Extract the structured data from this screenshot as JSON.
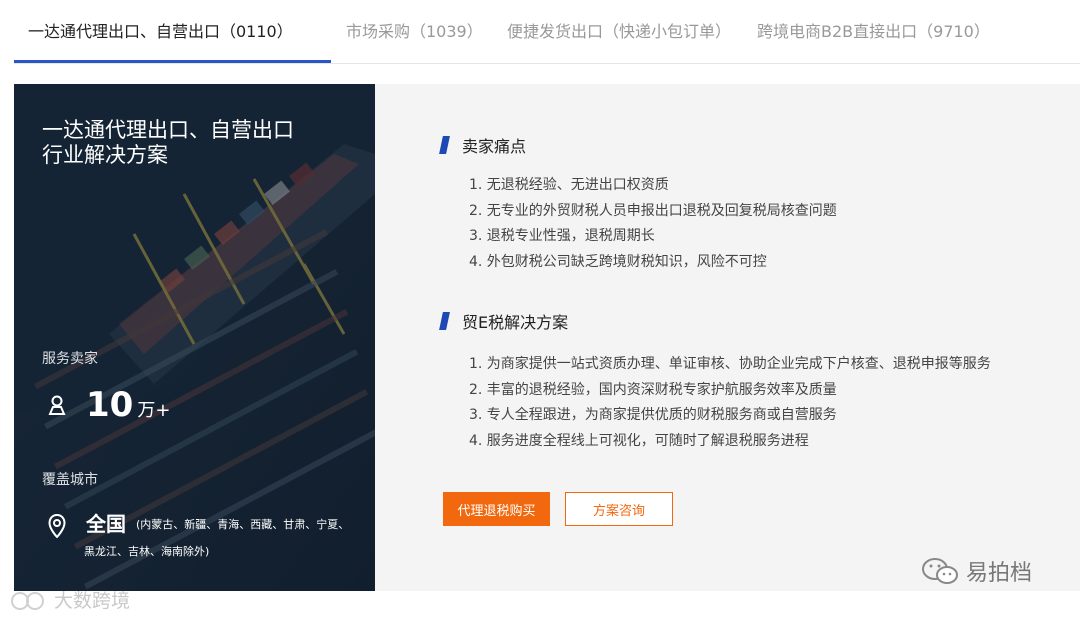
{
  "tabs": [
    {
      "label": "一达通代理出口、自营出口（0110）",
      "active": true
    },
    {
      "label": "市场采购（1039）",
      "active": false
    },
    {
      "label": "便捷发货出口（快递小包订单）",
      "active": false
    },
    {
      "label": "跨境电商B2B直接出口（9710）",
      "active": false
    }
  ],
  "hero": {
    "title_line1": "一达通代理出口、自营出口",
    "title_line2": "行业解决方案",
    "sellers_label": "服务卖家",
    "sellers_number": "10",
    "sellers_unit": "万+",
    "coverage_label": "覆盖城市",
    "coverage_big": "全国",
    "coverage_detail_line1": "(内蒙古、新疆、青海、西藏、甘肃、宁夏、",
    "coverage_detail_line2": "黑龙江、吉林、海南除外)"
  },
  "pain_points": {
    "heading": "卖家痛点",
    "items": [
      "1. 无退税经验、无进出口权资质",
      "2. 无专业的外贸财税人员申报出口退税及回复税局核查问题",
      "3. 退税专业性强，退税周期长",
      "4. 外包财税公司缺乏跨境财税知识，风险不可控"
    ]
  },
  "solution": {
    "heading": "贸E税解决方案",
    "items": [
      "1. 为商家提供一站式资质办理、单证审核、协助企业完成下户核查、退税申报等服务",
      "2. 丰富的退税经验，国内资深财税专家护航服务效率及质量",
      "3. 专人全程跟进，为商家提供优质的财税服务商或自营服务",
      "4. 服务进度全程线上可视化，可随时了解退税服务进程"
    ]
  },
  "buttons": {
    "primary": "代理退税购买",
    "secondary": "方案咨询"
  },
  "watermarks": {
    "left": "大数跨境",
    "right": "易拍档"
  },
  "colors": {
    "accent_blue": "#2a55c5",
    "orange": "#f2680f"
  }
}
